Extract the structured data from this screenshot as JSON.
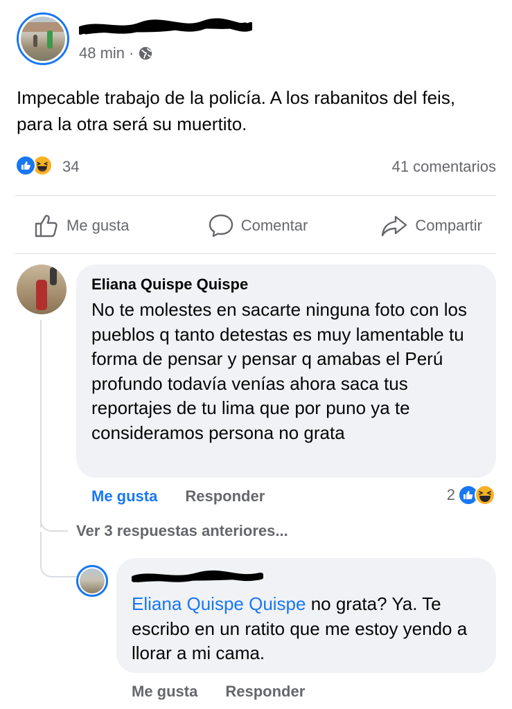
{
  "post": {
    "author_redacted": "",
    "time": "48 min",
    "separator": "·",
    "text": "Impecable trabajo de la policía. A los rabanitos del feis, para la otra será su muertito.",
    "reactions_count": "34",
    "comments_count": "41 comentarios"
  },
  "actions": {
    "like": "Me gusta",
    "comment": "Comentar",
    "share": "Compartir"
  },
  "comment1": {
    "author": "Eliana Quispe Quispe",
    "text": "No te molestes en sacarte ninguna foto con los pueblos q tanto detestas es muy lamentable tu forma de pensar y pensar q amabas el Perú profundo todavía venías ahora saca tus reportajes de tu lima que por puno ya te consideramos persona no grata",
    "like_label": "Me gusta",
    "reply_label": "Responder",
    "reactions_count": "2"
  },
  "view_previous": "Ver 3 respuestas anteriores...",
  "comment2": {
    "author_redacted": "",
    "mention": "Eliana Quispe Quispe",
    "text": " no grata? Ya. Te escribo en un ratito que me estoy yendo a llorar a mi cama.",
    "like_label": "Me gusta",
    "reply_label": "Responder"
  },
  "icons": [
    "globe-icon",
    "like-outline-icon",
    "comment-icon",
    "share-icon",
    "like-reaction-icon",
    "haha-reaction-icon"
  ],
  "colors": {
    "accent": "#1877f2",
    "muted": "#65676b",
    "bubble": "#f0f2f5",
    "text": "#050505"
  }
}
